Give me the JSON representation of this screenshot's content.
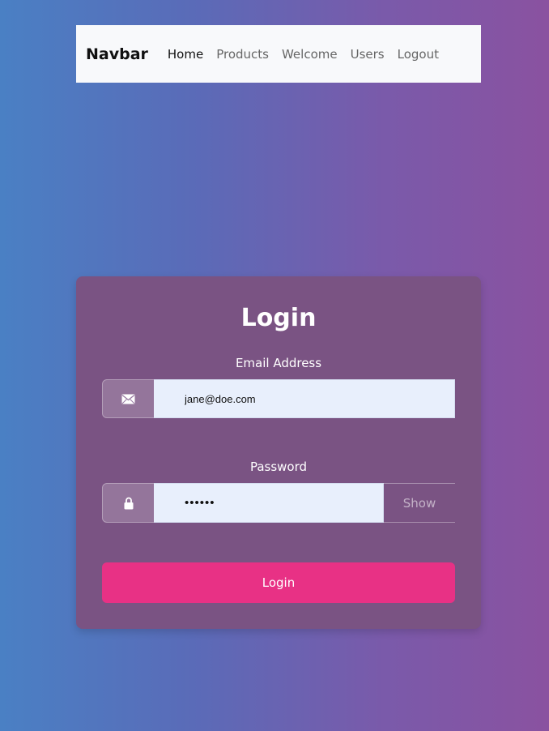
{
  "navbar": {
    "brand": "Navbar",
    "links": [
      {
        "label": "Home",
        "active": true
      },
      {
        "label": "Products",
        "active": false
      },
      {
        "label": "Welcome",
        "active": false
      },
      {
        "label": "Users",
        "active": false
      },
      {
        "label": "Logout",
        "active": false
      }
    ]
  },
  "login": {
    "title": "Login",
    "email": {
      "label": "Email Address",
      "value": "jane@doe.com",
      "icon": "envelope-icon"
    },
    "password": {
      "label": "Password",
      "value": "secret",
      "icon": "lock-icon",
      "toggle_label": "Show"
    },
    "submit_label": "Login"
  },
  "colors": {
    "card_bg": "#7a5383",
    "submit_bg": "#e83185",
    "input_bg": "#e8effc",
    "navbar_bg": "#f8f9fb"
  }
}
